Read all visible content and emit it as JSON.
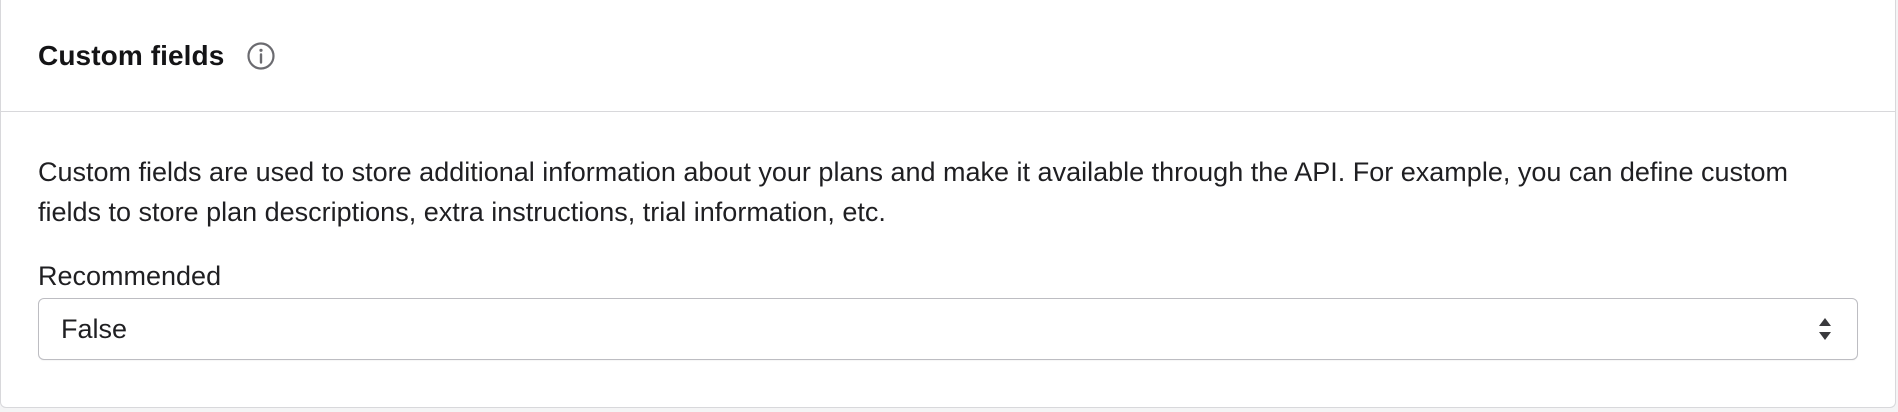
{
  "section": {
    "title": "Custom fields",
    "info_icon": "info-circle-icon",
    "description": "Custom fields are used to store additional information about your plans and make it available through the API. For example, you can define custom fields to store plan descriptions, extra instructions, trial information, etc."
  },
  "fields": {
    "recommended": {
      "label": "Recommended",
      "selected_value": "False",
      "caret_icon": "select-caret-icon"
    }
  }
}
